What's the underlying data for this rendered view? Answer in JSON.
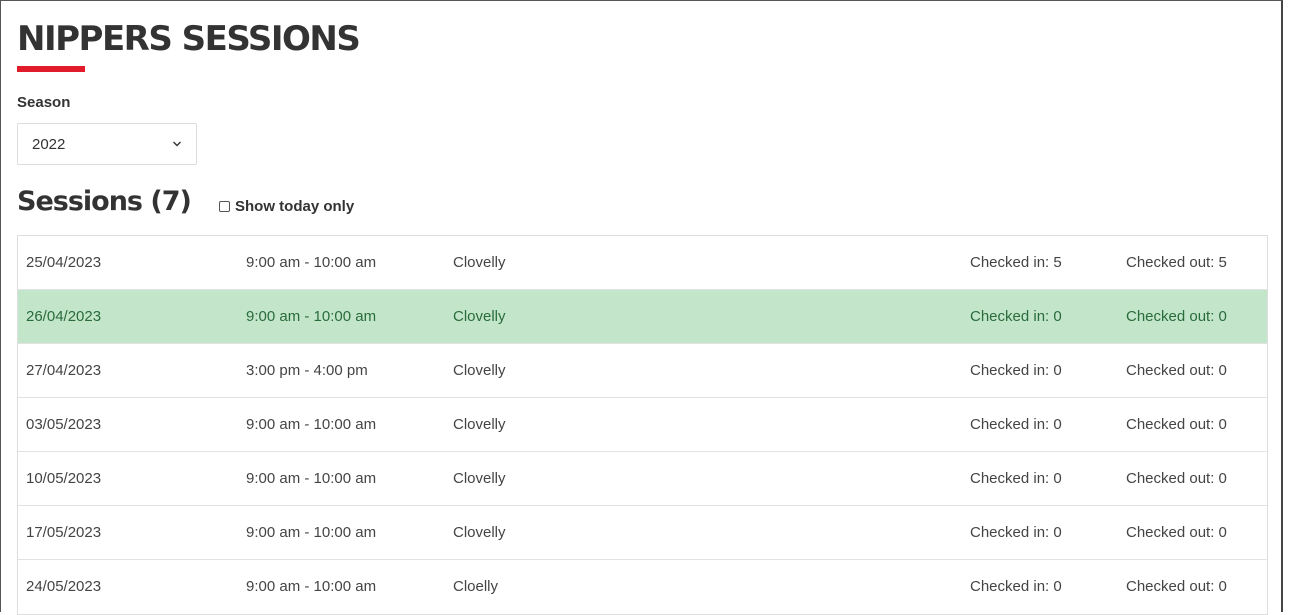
{
  "page": {
    "title": "NIPPERS SESSIONS",
    "accent_color": "#e21b2a"
  },
  "season": {
    "label": "Season",
    "selected": "2022",
    "icon": "chevron-down-icon"
  },
  "sessions": {
    "heading": "Sessions (7)",
    "show_today_label": "Show today only",
    "show_today_checked": false,
    "highlight_color": "#c3e6cb",
    "rows": [
      {
        "date": "25/04/2023",
        "time": "9:00 am - 10:00 am",
        "location": "Clovelly",
        "checked_in": "Checked in: 5",
        "checked_out": "Checked out: 5",
        "highlighted": false
      },
      {
        "date": "26/04/2023",
        "time": "9:00 am - 10:00 am",
        "location": "Clovelly",
        "checked_in": "Checked in: 0",
        "checked_out": "Checked out: 0",
        "highlighted": true
      },
      {
        "date": "27/04/2023",
        "time": "3:00 pm - 4:00 pm",
        "location": "Clovelly",
        "checked_in": "Checked in: 0",
        "checked_out": "Checked out: 0",
        "highlighted": false
      },
      {
        "date": "03/05/2023",
        "time": "9:00 am - 10:00 am",
        "location": "Clovelly",
        "checked_in": "Checked in: 0",
        "checked_out": "Checked out: 0",
        "highlighted": false
      },
      {
        "date": "10/05/2023",
        "time": "9:00 am - 10:00 am",
        "location": "Clovelly",
        "checked_in": "Checked in: 0",
        "checked_out": "Checked out: 0",
        "highlighted": false
      },
      {
        "date": "17/05/2023",
        "time": "9:00 am - 10:00 am",
        "location": "Clovelly",
        "checked_in": "Checked in: 0",
        "checked_out": "Checked out: 0",
        "highlighted": false
      },
      {
        "date": "24/05/2023",
        "time": "9:00 am - 10:00 am",
        "location": "Cloelly",
        "checked_in": "Checked in: 0",
        "checked_out": "Checked out: 0",
        "highlighted": false
      }
    ]
  }
}
